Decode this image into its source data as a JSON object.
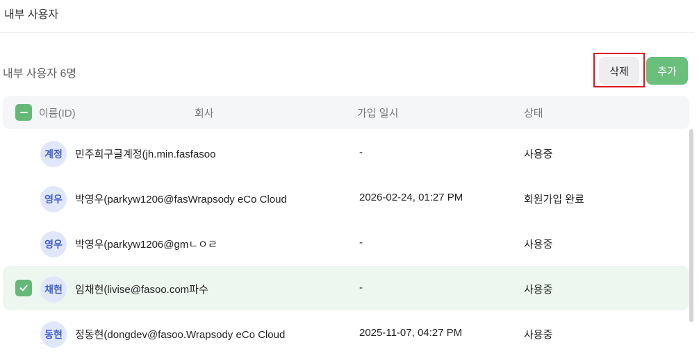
{
  "page": {
    "title": "내부 사용자"
  },
  "toolbar": {
    "count_label": "내부 사용자 6명",
    "delete_label": "삭제",
    "add_label": "추가"
  },
  "table": {
    "columns": [
      "이름(ID)",
      "회사",
      "가입 일시",
      "상태"
    ],
    "rows": [
      {
        "avatar": "계정",
        "name": "민주희구글계정(jh.min.fasfasoo",
        "date": "-",
        "status": "사용중",
        "selected": false
      },
      {
        "avatar": "영우",
        "name": "박영우(parkyw1206@fasWrapsody eCo Cloud",
        "date": "2026-02-24, 01:27 PM",
        "status": "회원가입 완료",
        "selected": false
      },
      {
        "avatar": "영우",
        "name": "박영우(parkyw1206@gmㄴㅇㄹ",
        "date": "-",
        "status": "사용중",
        "selected": false
      },
      {
        "avatar": "채현",
        "name": "임채현(livise@fasoo.com파수",
        "date": "-",
        "status": "사용중",
        "selected": true
      },
      {
        "avatar": "동현",
        "name": "정동현(dongdev@fasoo.Wrapsody eCo Cloud",
        "date": "2025-11-07, 04:27 PM",
        "status": "사용중",
        "selected": false
      }
    ]
  },
  "colors": {
    "accent": "#6bbf7c",
    "highlight_border": "#d9161c",
    "avatar_bg": "#e1e7fb",
    "avatar_text": "#3e5ecc"
  }
}
